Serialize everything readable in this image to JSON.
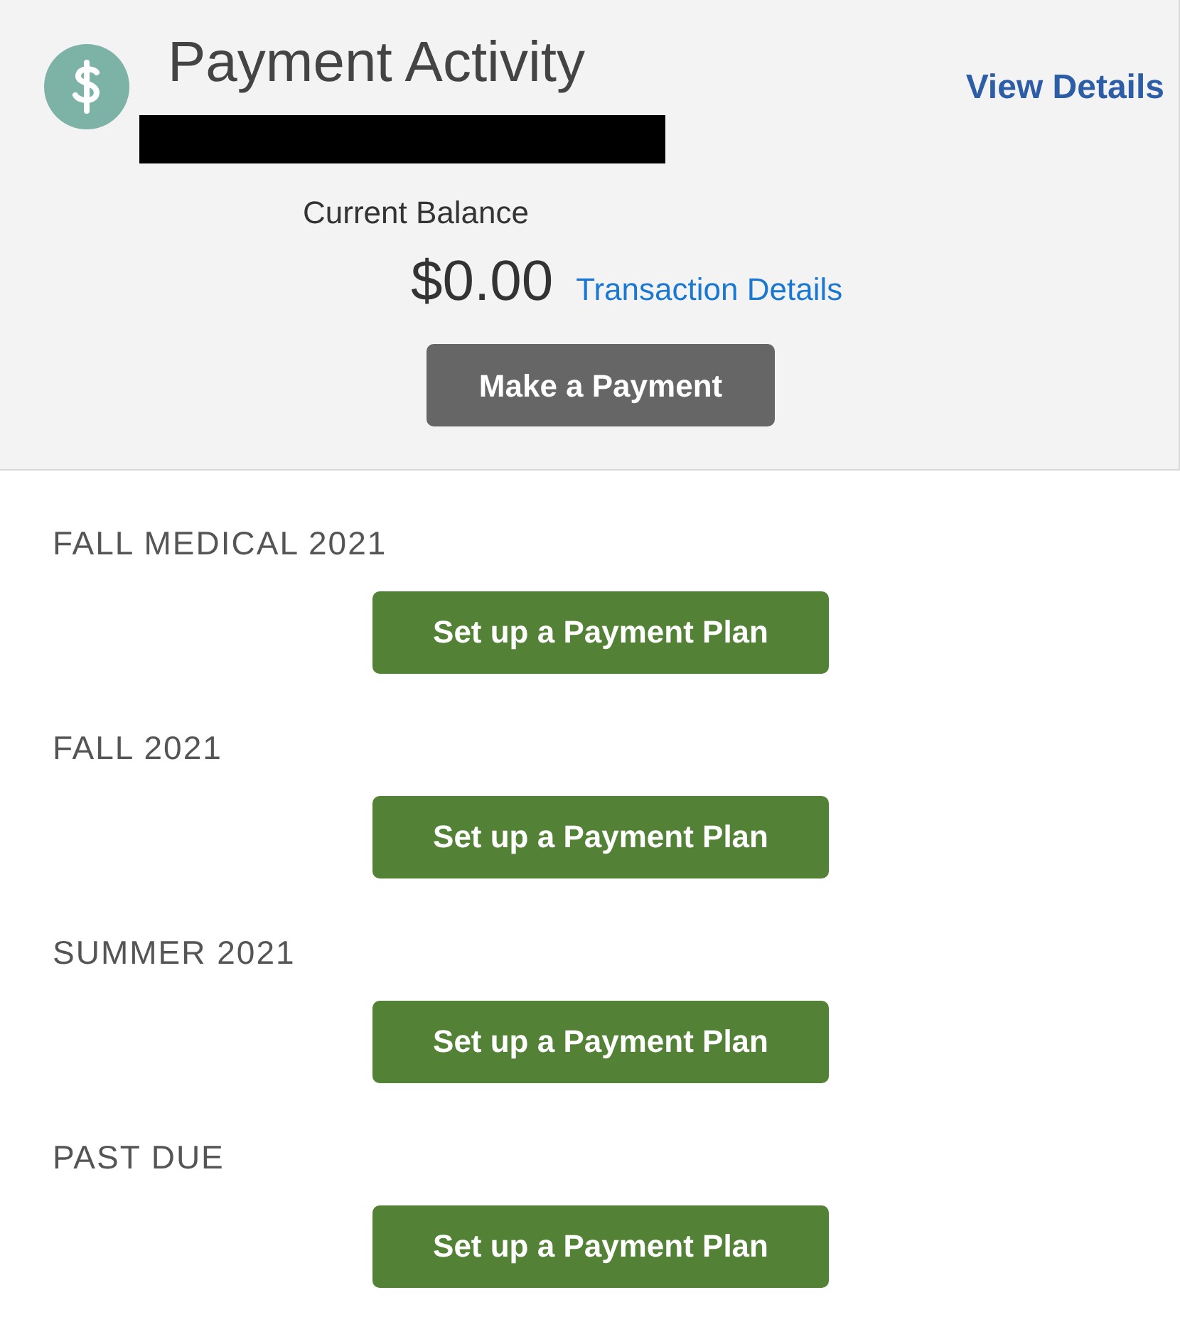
{
  "header": {
    "title": "Payment Activity",
    "view_details": "View Details",
    "balance_label": "Current Balance",
    "balance": "$0.00",
    "transaction_link": "Transaction Details",
    "pay_button": "Make a Payment"
  },
  "sections": [
    {
      "title": "FALL MEDICAL 2021",
      "button": "Set up a Payment Plan"
    },
    {
      "title": "FALL 2021",
      "button": "Set up a Payment Plan"
    },
    {
      "title": "SUMMER 2021",
      "button": "Set up a Payment Plan"
    },
    {
      "title": "PAST DUE",
      "button": "Set up a Payment Plan"
    }
  ]
}
